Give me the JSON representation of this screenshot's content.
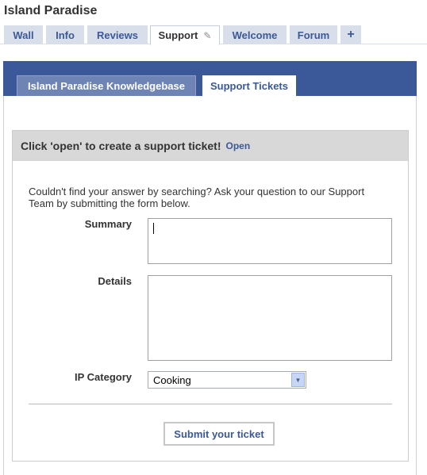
{
  "page": {
    "title": "Island Paradise"
  },
  "tabs": [
    {
      "label": "Wall"
    },
    {
      "label": "Info"
    },
    {
      "label": "Reviews"
    },
    {
      "label": "Support"
    },
    {
      "label": "Welcome"
    },
    {
      "label": "Forum"
    }
  ],
  "tab_icons": {
    "edit": "pencil-icon",
    "add": "plus-icon",
    "add_glyph": "+"
  },
  "app": {
    "subtabs": [
      {
        "label": "Island Paradise Knowledgebase"
      },
      {
        "label": "Support Tickets"
      }
    ]
  },
  "ticket": {
    "heading": "Click 'open' to create a support ticket!",
    "open_link": "Open",
    "intro": "Couldn't find your answer by searching? Ask your question to our Support Team by submitting the form below.",
    "summary_label": "Summary",
    "summary_value": "",
    "details_label": "Details",
    "details_value": "",
    "category_label": "IP Category",
    "category_selected": "Cooking",
    "submit_label": "Submit your ticket"
  },
  "colors": {
    "brand": "#3b5998",
    "tab_bg": "#d8dfea",
    "panel_head_bg": "#d8d8d8"
  }
}
